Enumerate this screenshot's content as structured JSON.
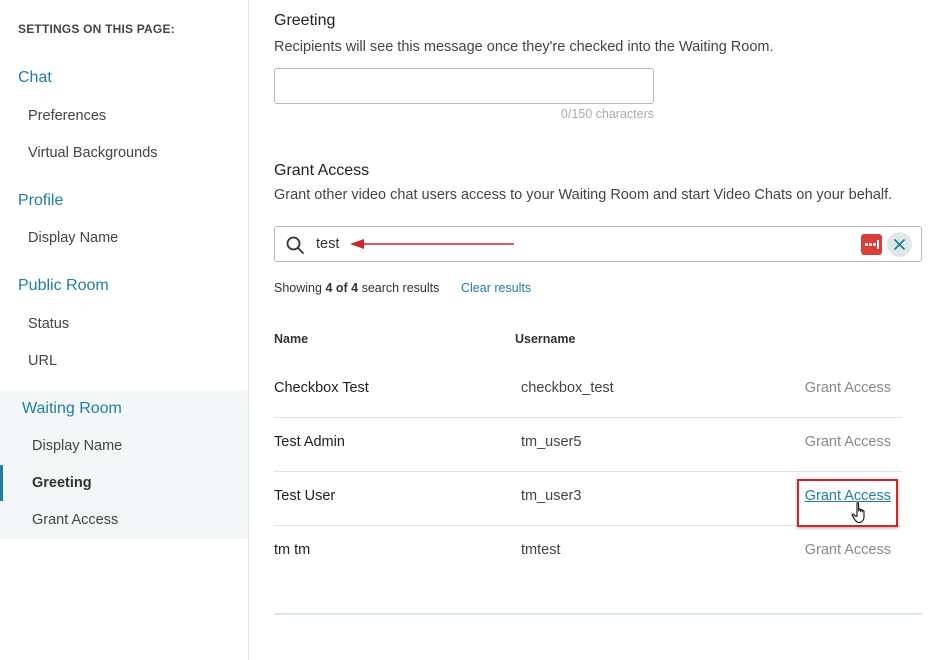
{
  "sidebar": {
    "heading": "SETTINGS ON THIS PAGE:",
    "chat": {
      "title": "Chat",
      "items": [
        "Preferences",
        "Virtual Backgrounds"
      ]
    },
    "profile": {
      "title": "Profile",
      "items": [
        "Display Name"
      ]
    },
    "public_room": {
      "title": "Public Room",
      "items": [
        "Status",
        "URL"
      ]
    },
    "waiting_room": {
      "title": "Waiting Room",
      "items": [
        "Display Name",
        "Greeting",
        "Grant Access"
      ],
      "active_item": "Greeting"
    }
  },
  "greeting": {
    "title": "Greeting",
    "description": "Recipients will see this message once they're checked into the Waiting Room.",
    "value": "",
    "char_count": "0/150 characters"
  },
  "grant_access": {
    "title": "Grant Access",
    "description": "Grant other video chat users access to your Waiting Room and start Video Chats on your behalf.",
    "search_value": "test",
    "results_prefix": "Showing ",
    "results_count": "4 of 4",
    "results_suffix": " search results",
    "clear_results": "Clear results",
    "columns": {
      "name": "Name",
      "username": "Username"
    },
    "rows": [
      {
        "name": "Checkbox Test",
        "username": "checkbox_test",
        "action": "Grant Access"
      },
      {
        "name": "Test Admin",
        "username": "tm_user5",
        "action": "Grant Access"
      },
      {
        "name": "Test User",
        "username": "tm_user3",
        "action": "Grant Access"
      },
      {
        "name": "tm tm",
        "username": "tmtest",
        "action": "Grant Access"
      }
    ]
  },
  "icons": {
    "search": "search-icon",
    "password_manager": "password-manager-icon",
    "clear": "close-icon",
    "cursor": "hand-pointer-icon"
  },
  "colors": {
    "accent": "#1f7ea8",
    "annotation_red": "#d0262b",
    "password_manager_red": "#d9403a"
  }
}
